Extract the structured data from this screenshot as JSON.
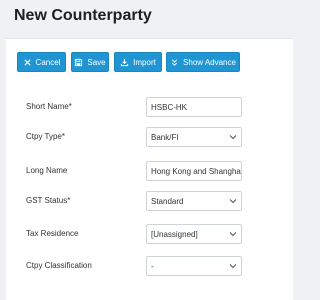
{
  "page": {
    "title": "New Counterparty"
  },
  "toolbar": {
    "cancel_label": "Cancel",
    "save_label": "Save",
    "import_label": "Import",
    "advance_label": "Show Advance",
    "button_color": "#1f96d3"
  },
  "form": {
    "short_name": {
      "label": "Short Name*",
      "value": "HSBC-HK"
    },
    "ctpy_type": {
      "label": "Ctpy Type*",
      "value": "Bank/FI"
    },
    "long_name": {
      "label": "Long Name",
      "value": "Hong Kong and Shanghai"
    },
    "gst_status": {
      "label": "GST Status*",
      "value": "Standard"
    },
    "tax_residence": {
      "label": "Tax Residence",
      "value": "[Unassigned]"
    },
    "ctpy_classification": {
      "label": "Ctpy Classification",
      "value": "-"
    }
  }
}
